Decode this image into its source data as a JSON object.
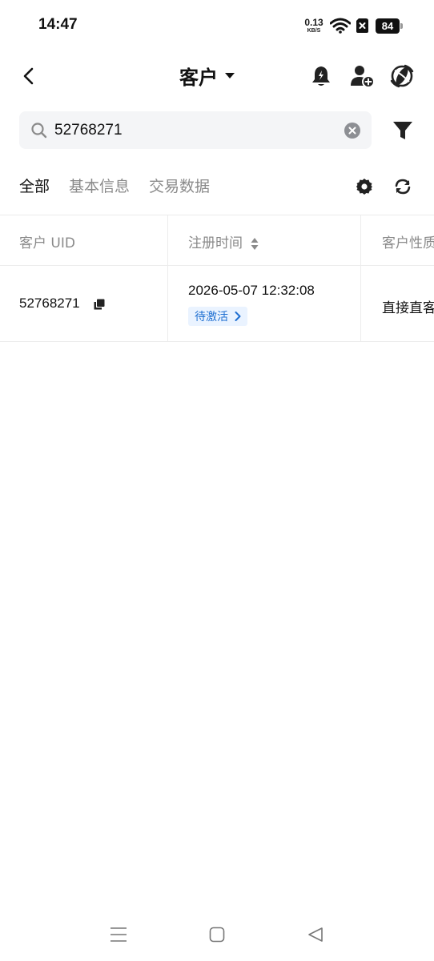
{
  "status_bar": {
    "time": "14:47",
    "net_speed_value": "0.13",
    "net_speed_unit": "KB/S",
    "battery": "84"
  },
  "header": {
    "title": "客户",
    "icons": [
      "back-icon",
      "caret-down-icon",
      "bell-icon",
      "add-user-icon",
      "globe-icon"
    ]
  },
  "search": {
    "value": "52768271",
    "icons": [
      "search-icon",
      "clear-icon",
      "filter-icon"
    ]
  },
  "tabs": [
    {
      "label": "全部",
      "active": true
    },
    {
      "label": "基本信息",
      "active": false
    },
    {
      "label": "交易数据",
      "active": false
    }
  ],
  "table": {
    "columns": [
      "客户 UID",
      "注册时间",
      "客户性质"
    ],
    "rows": [
      {
        "uid": "52768271",
        "register_time": "2026-05-07 12:32:08",
        "status": "待激活",
        "nature": "直接直客"
      }
    ]
  },
  "colors": {
    "accent": "#1f6fd1",
    "tag_bg": "#eaf3ff",
    "search_bg": "#f4f5f7",
    "divider": "#ececec",
    "muted_text": "#8a8a8a"
  }
}
